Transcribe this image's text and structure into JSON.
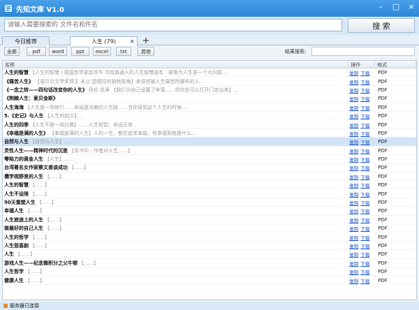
{
  "window": {
    "title": "先知文库 V1.0"
  },
  "search": {
    "placeholder": "请输入需要搜索的 文件名和件名",
    "button_label": "搜 索"
  },
  "tabs": [
    {
      "label": "今日推荐",
      "close": ""
    },
    {
      "label": "人生 (79)",
      "close": "×"
    }
  ],
  "tab_add": "+",
  "filters": [
    "全部",
    "pdf",
    "word",
    "ppt",
    "excel",
    "txt",
    "其他"
  ],
  "results_label": "结果搜索:",
  "table": {
    "headers": [
      "名称",
      "操作",
      "格式"
    ],
    "op_labels": [
      "复制",
      "下载"
    ],
    "rows": [
      {
        "title": "人生的智慧",
        "snippet": "【人生的智慧 | 德国哲学家叔本华 写给普通人的人生智慧读本｜被誉为人生是一个大问题...",
        "format": "PDF"
      },
      {
        "title": "《痛苦人生》",
        "snippet": "【诺贝尔文学奖得主 米兰·昆德拉的独特视角】来讲述被人生痛苦所摆布的人...",
        "format": "PDF"
      },
      {
        "title": "《一念之转——四句话改变你的人生》",
        "snippet": "拜伦·凯蒂 【我们为自己设置了牢笼……但你总可以打开门走出来】...",
        "format": "PDF"
      },
      {
        "title": "《荆棘人生：索贝金斯》",
        "snippet": "",
        "format": "PDF"
      },
      {
        "title": "人生海海",
        "snippet": "【人生是一场修行……命运是活着的人生路……当你读到这个人生的时候...",
        "format": "PDF"
      },
      {
        "title": "5.《史记》与人生",
        "snippet": "【人生的启示】...",
        "format": "PDF"
      },
      {
        "title": "人生的四季",
        "snippet": "【人生不是一场比赛】……人生短暂，命运无常...",
        "format": "PDF"
      },
      {
        "title": "《幸福是满的人生》",
        "snippet": "【幸福是满的人生】人的一生，都在追求幸福，但幸福到底是什么...",
        "format": "PDF"
      },
      {
        "title": "自然与人生",
        "snippet": "【自然与人生】……",
        "format": "PDF"
      },
      {
        "title": "灵性人生——精神时代的沉思",
        "snippet": "【本书中，作者对人生……】",
        "format": "PDF"
      },
      {
        "title": "零陷力的黄金人生",
        "snippet": "【人生】……",
        "format": "PDF"
      },
      {
        "title": "台湾著名女作家蔡文甫谈成功",
        "snippet": "【……】",
        "format": "PDF"
      },
      {
        "title": "儒学视野里的人生",
        "snippet": "【……】",
        "format": "PDF"
      },
      {
        "title": "人生的智慧",
        "snippet": "【……】",
        "format": "PDF"
      },
      {
        "title": "人生不设限",
        "snippet": "【……】",
        "format": "PDF"
      },
      {
        "title": "90天重塑人生",
        "snippet": "【……】",
        "format": "PDF"
      },
      {
        "title": "幸福人生",
        "snippet": "【……】",
        "format": "PDF"
      },
      {
        "title": "人生旅途上的人生",
        "snippet": "【……】",
        "format": "PDF"
      },
      {
        "title": "做最好的自己人生",
        "snippet": "【……】",
        "format": "PDF"
      },
      {
        "title": "人生的哲学",
        "snippet": "【……】",
        "format": "PDF"
      },
      {
        "title": "人生悲喜剧",
        "snippet": "【……】",
        "format": "PDF"
      },
      {
        "title": "人生",
        "snippet": "【……】",
        "format": "PDF"
      },
      {
        "title": "游戏人生——纪念微积分之父牛顿",
        "snippet": "【……】",
        "format": "PDF"
      },
      {
        "title": "人生哲学",
        "snippet": "【……】",
        "format": "PDF"
      },
      {
        "title": "健康人生",
        "snippet": "【……】",
        "format": "PDF"
      }
    ]
  },
  "status": {
    "text": "服务器已连接"
  },
  "colors": {
    "titlebar": "#2c86d8",
    "link": "#1a55c9",
    "selected_row": "#d0e4f7"
  }
}
